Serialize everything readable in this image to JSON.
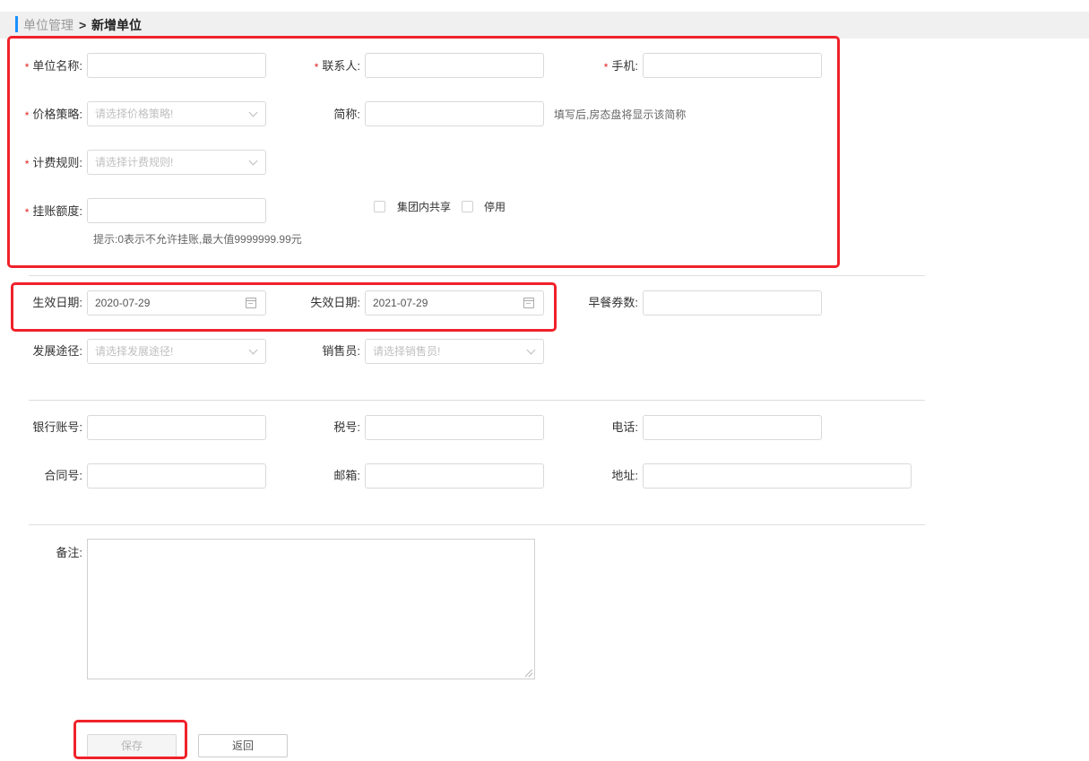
{
  "breadcrumb": {
    "parent": "单位管理",
    "separator": ">",
    "current": "新增单位"
  },
  "required_mark": "*",
  "form": {
    "unit_name": {
      "label": "单位名称:",
      "value": ""
    },
    "contact": {
      "label": "联系人:",
      "value": ""
    },
    "mobile": {
      "label": "手机:",
      "value": ""
    },
    "price_policy": {
      "label": "价格策略:",
      "placeholder": "请选择价格策略!"
    },
    "short_name": {
      "label": "简称:",
      "value": "",
      "hint": "填写后,房态盘将显示该简称"
    },
    "billing_rule": {
      "label": "计费规则:",
      "placeholder": "请选择计费规则!"
    },
    "credit_limit": {
      "label": "挂账额度:",
      "value": "",
      "hint": "提示:0表示不允许挂账,最大值9999999.99元"
    },
    "group_share": {
      "label": "集团内共享",
      "checked": false
    },
    "disabled": {
      "label": "停用",
      "checked": false
    },
    "effective_date": {
      "label": "生效日期:",
      "value": "2020-07-29"
    },
    "expiry_date": {
      "label": "失效日期:",
      "value": "2021-07-29"
    },
    "breakfast_count": {
      "label": "早餐券数:",
      "value": ""
    },
    "source": {
      "label": "发展途径:",
      "placeholder": "请选择发展途径!"
    },
    "salesperson": {
      "label": "销售员:",
      "placeholder": "请选择销售员!"
    },
    "bank_account": {
      "label": "银行账号:",
      "value": ""
    },
    "tax_number": {
      "label": "税号:",
      "value": ""
    },
    "phone": {
      "label": "电话:",
      "value": ""
    },
    "contract_number": {
      "label": "合同号:",
      "value": ""
    },
    "email": {
      "label": "邮箱:",
      "value": ""
    },
    "address": {
      "label": "地址:",
      "value": ""
    },
    "remarks": {
      "label": "备注:",
      "value": ""
    }
  },
  "buttons": {
    "save": "保存",
    "back": "返回"
  },
  "colors": {
    "accent": "#1890ff",
    "highlight": "#f0222a",
    "required": "#e02020"
  }
}
